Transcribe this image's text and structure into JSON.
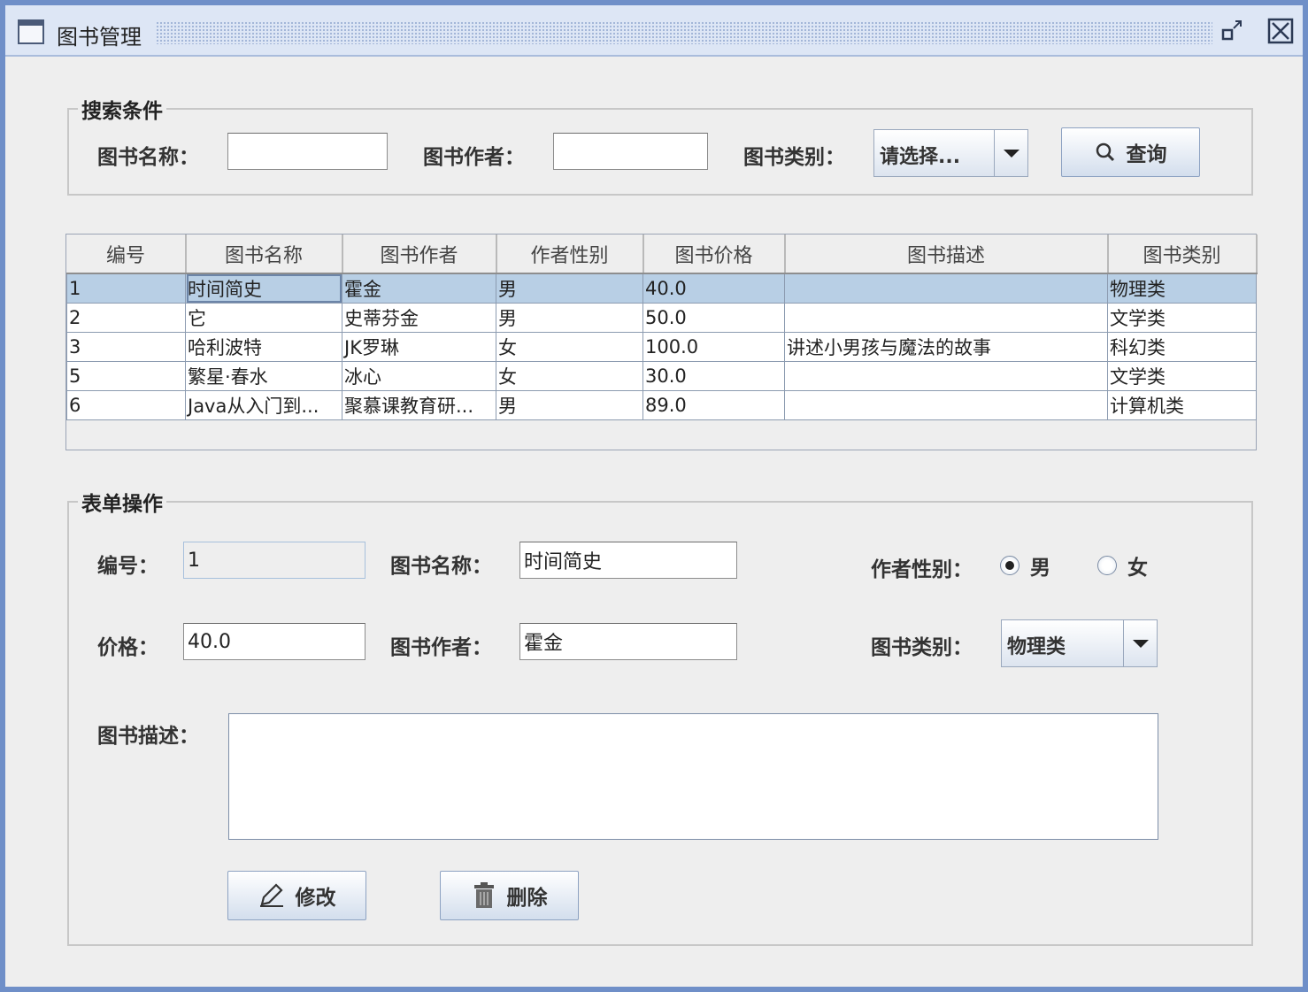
{
  "window": {
    "title": "图书管理"
  },
  "search": {
    "legend": "搜索条件",
    "name_label": "图书名称：",
    "name_value": "",
    "author_label": "图书作者：",
    "author_value": "",
    "category_label": "图书类别：",
    "category_selected": "请选择...",
    "query_button": "查询"
  },
  "table": {
    "columns": [
      "编号",
      "图书名称",
      "图书作者",
      "作者性别",
      "图书价格",
      "图书描述",
      "图书类别"
    ],
    "rows": [
      {
        "id": "1",
        "name": "时间简史",
        "author": "霍金",
        "gender": "男",
        "price": "40.0",
        "desc": "",
        "category": "物理类"
      },
      {
        "id": "2",
        "name": "它",
        "author": "史蒂芬金",
        "gender": "男",
        "price": "50.0",
        "desc": "",
        "category": "文学类"
      },
      {
        "id": "3",
        "name": "哈利波特",
        "author": "JK罗琳",
        "gender": "女",
        "price": "100.0",
        "desc": "讲述小男孩与魔法的故事",
        "category": "科幻类"
      },
      {
        "id": "5",
        "name": "繁星·春水",
        "author": "冰心",
        "gender": "女",
        "price": "30.0",
        "desc": "",
        "category": "文学类"
      },
      {
        "id": "6",
        "name": "Java从入门到...",
        "author": "聚慕课教育研...",
        "gender": "男",
        "price": "89.0",
        "desc": "",
        "category": "计算机类"
      }
    ],
    "selected_row": 0
  },
  "form": {
    "legend": "表单操作",
    "id_label": "编号：",
    "id_value": "1",
    "name_label": "图书名称：",
    "name_value": "时间简史",
    "gender_label": "作者性别：",
    "gender_male": "男",
    "gender_female": "女",
    "gender_selected": "男",
    "price_label": "价格：",
    "price_value": "40.0",
    "author_label": "图书作者：",
    "author_value": "霍金",
    "category_label": "图书类别：",
    "category_selected": "物理类",
    "desc_label": "图书描述：",
    "desc_value": "",
    "modify_button": "修改",
    "delete_button": "删除"
  }
}
